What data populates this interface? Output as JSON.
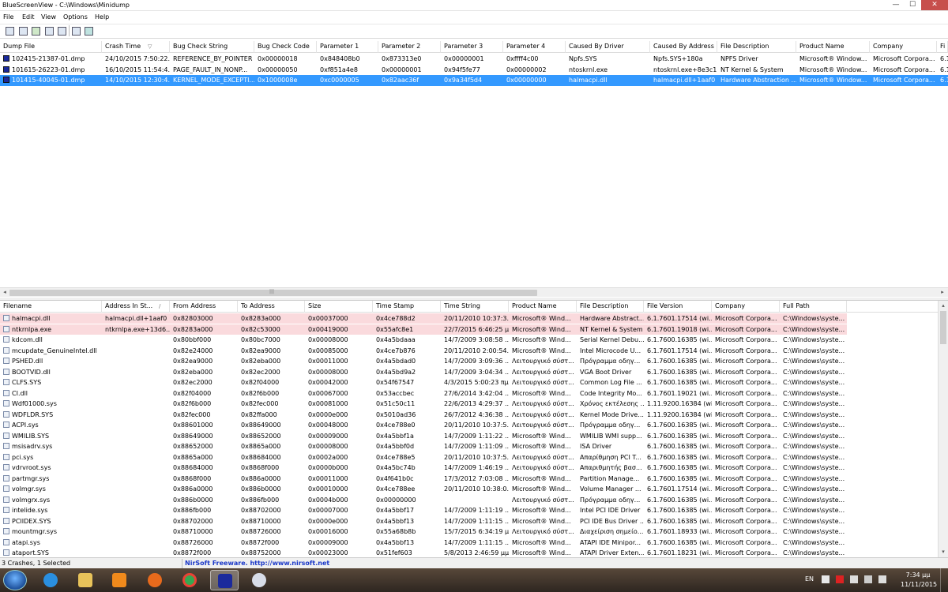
{
  "window": {
    "title": "BlueScreenView  -  C:\\Windows\\Minidump",
    "minimize": "—",
    "maximize": "☐",
    "close": "✕"
  },
  "menu": [
    "File",
    "Edit",
    "View",
    "Options",
    "Help"
  ],
  "toolbar_icons": [
    "save-icon",
    "floppy-icon",
    "refresh-icon",
    "copy-icon",
    "html-report-icon",
    "properties-icon",
    "exit-icon"
  ],
  "crash_table": {
    "columns": [
      "Dump File",
      "Crash Time",
      "Bug Check String",
      "Bug Check Code",
      "Parameter 1",
      "Parameter 2",
      "Parameter 3",
      "Parameter 4",
      "Caused By Driver",
      "Caused By Address",
      "File Description",
      "Product Name",
      "Company",
      "Fi"
    ],
    "sort_glyph": "▽",
    "rows": [
      {
        "cells": [
          "102415-21387-01.dmp",
          "24/10/2015 7:50:22...",
          "REFERENCE_BY_POINTER",
          "0x00000018",
          "0x848408b0",
          "0x873313e0",
          "0x00000001",
          "0xffff4c00",
          "Npfs.SYS",
          "Npfs.SYS+180a",
          "NPFS Driver",
          "Microsoft® Window...",
          "Microsoft Corpora...",
          "6.1"
        ],
        "selected": false
      },
      {
        "cells": [
          "101615-26223-01.dmp",
          "16/10/2015 11:54:4...",
          "PAGE_FAULT_IN_NONP...",
          "0x00000050",
          "0xf851a4e8",
          "0x00000001",
          "0x94f5fe77",
          "0x00000002",
          "ntoskrnl.exe",
          "ntoskrnl.exe+8e3c1",
          "NT Kernel & System",
          "Microsoft® Window...",
          "Microsoft Corpora...",
          "6.1"
        ],
        "selected": false
      },
      {
        "cells": [
          "101415-40045-01.dmp",
          "14/10/2015 12:30:4...",
          "KERNEL_MODE_EXCEPTI...",
          "0x1000008e",
          "0xc0000005",
          "0x82aac36f",
          "0x9a34f5d4",
          "0x00000000",
          "halmacpi.dll",
          "halmacpi.dll+1aaf0",
          "Hardware Abstraction ...",
          "Microsoft® Window...",
          "Microsoft Corpora...",
          "6.1"
        ],
        "selected": true
      }
    ]
  },
  "hscroll": {
    "left": "◂",
    "right": "▸",
    "grip": "|||"
  },
  "vscroll": {
    "up": "▴",
    "down": "▾"
  },
  "driver_table": {
    "columns": [
      "Filename",
      "Address In St...",
      "From Address",
      "To Address",
      "Size",
      "Time Stamp",
      "Time String",
      "Product Name",
      "File Description",
      "File Version",
      "Company",
      "Full Path"
    ],
    "sort_glyph": "/",
    "rows": [
      {
        "cells": [
          "halmacpi.dll",
          "halmacpi.dll+1aaf0",
          "0x82803000",
          "0x8283a000",
          "0x00037000",
          "0x4ce788d2",
          "20/11/2010 10:37:3...",
          "Microsoft® Wind...",
          "Hardware Abstract...",
          "6.1.7601.17514 (wi...",
          "Microsoft Corpora...",
          "C:\\Windows\\syste..."
        ],
        "pink": true
      },
      {
        "cells": [
          "ntkrnlpa.exe",
          "ntkrnlpa.exe+13d6...",
          "0x8283a000",
          "0x82c53000",
          "0x00419000",
          "0x55afc8e1",
          "22/7/2015 6:46:25 μμ",
          "Microsoft® Wind...",
          "NT Kernel & System",
          "6.1.7601.19018 (wi...",
          "Microsoft Corpora...",
          "C:\\Windows\\syste..."
        ],
        "pink": true
      },
      {
        "cells": [
          "kdcom.dll",
          "",
          "0x80bbf000",
          "0x80bc7000",
          "0x00008000",
          "0x4a5bdaaa",
          "14/7/2009 3:08:58 ...",
          "Microsoft® Wind...",
          "Serial Kernel Debu...",
          "6.1.7600.16385 (wi...",
          "Microsoft Corpora...",
          "C:\\Windows\\syste..."
        ],
        "pink": false
      },
      {
        "cells": [
          "mcupdate_GenuineIntel.dll",
          "",
          "0x82e24000",
          "0x82ea9000",
          "0x00085000",
          "0x4ce7b876",
          "20/11/2010 2:00:54...",
          "Microsoft® Wind...",
          "Intel Microcode U...",
          "6.1.7601.17514 (wi...",
          "Microsoft Corpora...",
          "C:\\Windows\\syste..."
        ],
        "pink": false
      },
      {
        "cells": [
          "PSHED.dll",
          "",
          "0x82ea9000",
          "0x82eba000",
          "0x00011000",
          "0x4a5bdad0",
          "14/7/2009 3:09:36 ...",
          "Λειτουργικό σύστ...",
          "Πρόγραμμα οδηγ...",
          "6.1.7600.16385 (wi...",
          "Microsoft Corpora...",
          "C:\\Windows\\syste..."
        ],
        "pink": false
      },
      {
        "cells": [
          "BOOTVID.dll",
          "",
          "0x82eba000",
          "0x82ec2000",
          "0x00008000",
          "0x4a5bd9a2",
          "14/7/2009 3:04:34 ...",
          "Λειτουργικό σύστ...",
          "VGA Boot Driver",
          "6.1.7600.16385 (wi...",
          "Microsoft Corpora...",
          "C:\\Windows\\syste..."
        ],
        "pink": false
      },
      {
        "cells": [
          "CLFS.SYS",
          "",
          "0x82ec2000",
          "0x82f04000",
          "0x00042000",
          "0x54f67547",
          "4/3/2015 5:00:23 πμ",
          "Λειτουργικό σύστ...",
          "Common Log File ...",
          "6.1.7600.16385 (wi...",
          "Microsoft Corpora...",
          "C:\\Windows\\syste..."
        ],
        "pink": false
      },
      {
        "cells": [
          "CI.dll",
          "",
          "0x82f04000",
          "0x82f6b000",
          "0x00067000",
          "0x53accbec",
          "27/6/2014 3:42:04 ...",
          "Microsoft® Wind...",
          "Code Integrity Mo...",
          "6.1.7601.19021 (wi...",
          "Microsoft Corpora...",
          "C:\\Windows\\syste..."
        ],
        "pink": false
      },
      {
        "cells": [
          "Wdf01000.sys",
          "",
          "0x82f6b000",
          "0x82fec000",
          "0x00081000",
          "0x51c50c11",
          "22/6/2013 4:29:37 ...",
          "Λειτουργικό σύστ...",
          "Χρόνος εκτέλεσης ...",
          "1.11.9200.16384 (wi...",
          "Microsoft Corpora...",
          "C:\\Windows\\syste..."
        ],
        "pink": false
      },
      {
        "cells": [
          "WDFLDR.SYS",
          "",
          "0x82fec000",
          "0x82ffa000",
          "0x0000e000",
          "0x5010ad36",
          "26/7/2012 4:36:38 ...",
          "Λειτουργικό σύστ...",
          "Kernel Mode Drive...",
          "1.11.9200.16384 (wi...",
          "Microsoft Corpora...",
          "C:\\Windows\\syste..."
        ],
        "pink": false
      },
      {
        "cells": [
          "ACPI.sys",
          "",
          "0x88601000",
          "0x88649000",
          "0x00048000",
          "0x4ce788e0",
          "20/11/2010 10:37:5...",
          "Λειτουργικό σύστ...",
          "Πρόγραμμα οδηγ...",
          "6.1.7600.16385 (wi...",
          "Microsoft Corpora...",
          "C:\\Windows\\syste..."
        ],
        "pink": false
      },
      {
        "cells": [
          "WMILIB.SYS",
          "",
          "0x88649000",
          "0x88652000",
          "0x00009000",
          "0x4a5bbf1a",
          "14/7/2009 1:11:22 ...",
          "Microsoft® Wind...",
          "WMILIB WMI supp...",
          "6.1.7600.16385 (wi...",
          "Microsoft Corpora...",
          "C:\\Windows\\syste..."
        ],
        "pink": false
      },
      {
        "cells": [
          "msisadrv.sys",
          "",
          "0x88652000",
          "0x8865a000",
          "0x00008000",
          "0x4a5bbf0d",
          "14/7/2009 1:11:09 ...",
          "Microsoft® Wind...",
          "ISA Driver",
          "6.1.7600.16385 (wi...",
          "Microsoft Corpora...",
          "C:\\Windows\\syste..."
        ],
        "pink": false
      },
      {
        "cells": [
          "pci.sys",
          "",
          "0x8865a000",
          "0x88684000",
          "0x0002a000",
          "0x4ce788e5",
          "20/11/2010 10:37:5...",
          "Λειτουργικό σύστ...",
          "Απαρίθμηση PCI T...",
          "6.1.7600.16385 (wi...",
          "Microsoft Corpora...",
          "C:\\Windows\\syste..."
        ],
        "pink": false
      },
      {
        "cells": [
          "vdrvroot.sys",
          "",
          "0x88684000",
          "0x8868f000",
          "0x0000b000",
          "0x4a5bc74b",
          "14/7/2009 1:46:19 ...",
          "Λειτουργικό σύστ...",
          "Απαριθμητής βασ...",
          "6.1.7600.16385 (wi...",
          "Microsoft Corpora...",
          "C:\\Windows\\syste..."
        ],
        "pink": false
      },
      {
        "cells": [
          "partmgr.sys",
          "",
          "0x8868f000",
          "0x886a0000",
          "0x00011000",
          "0x4f641b0c",
          "17/3/2012 7:03:08 ...",
          "Microsoft® Wind...",
          "Partition Manage...",
          "6.1.7600.16385 (wi...",
          "Microsoft Corpora...",
          "C:\\Windows\\syste..."
        ],
        "pink": false
      },
      {
        "cells": [
          "volmgr.sys",
          "",
          "0x886a0000",
          "0x886b0000",
          "0x00010000",
          "0x4ce788ee",
          "20/11/2010 10:38:0...",
          "Microsoft® Wind...",
          "Volume Manager ...",
          "6.1.7601.17514 (wi...",
          "Microsoft Corpora...",
          "C:\\Windows\\syste..."
        ],
        "pink": false
      },
      {
        "cells": [
          "volmgrx.sys",
          "",
          "0x886b0000",
          "0x886fb000",
          "0x0004b000",
          "0x00000000",
          "",
          "Λειτουργικό σύστ...",
          "Πρόγραμμα οδηγ...",
          "6.1.7600.16385 (wi...",
          "Microsoft Corpora...",
          "C:\\Windows\\syste..."
        ],
        "pink": false
      },
      {
        "cells": [
          "intelide.sys",
          "",
          "0x886fb000",
          "0x88702000",
          "0x00007000",
          "0x4a5bbf17",
          "14/7/2009 1:11:19 ...",
          "Microsoft® Wind...",
          "Intel PCI IDE Driver",
          "6.1.7600.16385 (wi...",
          "Microsoft Corpora...",
          "C:\\Windows\\syste..."
        ],
        "pink": false
      },
      {
        "cells": [
          "PCIIDEX.SYS",
          "",
          "0x88702000",
          "0x88710000",
          "0x0000e000",
          "0x4a5bbf13",
          "14/7/2009 1:11:15 ...",
          "Microsoft® Wind...",
          "PCI IDE Bus Driver ...",
          "6.1.7600.16385 (wi...",
          "Microsoft Corpora...",
          "C:\\Windows\\syste..."
        ],
        "pink": false
      },
      {
        "cells": [
          "mountmgr.sys",
          "",
          "0x88710000",
          "0x88726000",
          "0x00016000",
          "0x55a68b8b",
          "15/7/2015 6:34:19 μμ",
          "Λειτουργικό σύστ...",
          "Διαχείριση σημείο...",
          "6.1.7601.18933 (wi...",
          "Microsoft Corpora...",
          "C:\\Windows\\syste..."
        ],
        "pink": false
      },
      {
        "cells": [
          "atapi.sys",
          "",
          "0x88726000",
          "0x8872f000",
          "0x00009000",
          "0x4a5bbf13",
          "14/7/2009 1:11:15 ...",
          "Microsoft® Wind...",
          "ATAPI IDE Minipor...",
          "6.1.7600.16385 (wi...",
          "Microsoft Corpora...",
          "C:\\Windows\\syste..."
        ],
        "pink": false
      },
      {
        "cells": [
          "ataport.SYS",
          "",
          "0x8872f000",
          "0x88752000",
          "0x00023000",
          "0x51fef603",
          "5/8/2013 2:46:59 μμ",
          "Microsoft® Wind...",
          "ATAPI Driver Exten...",
          "6.1.7601.18231 (wi...",
          "Microsoft Corpora...",
          "C:\\Windows\\syste..."
        ],
        "pink": false
      }
    ]
  },
  "status": {
    "count": "3 Crashes, 1 Selected",
    "link": "NirSoft Freeware.  http://www.nirsoft.net"
  },
  "taskbar": {
    "apps": [
      "start-orb",
      "internet-explorer-icon",
      "file-explorer-icon",
      "media-player-icon",
      "firefox-icon",
      "chrome-icon",
      "bluescreenview-icon",
      "paint-icon"
    ],
    "language": "EN",
    "time": "7:34 μμ",
    "date": "11/11/2015"
  },
  "colors": {
    "selection": "#3399ff",
    "pink_highlight": "#fadadd",
    "link": "#1a37c8",
    "close_button": "#c74f4c"
  }
}
